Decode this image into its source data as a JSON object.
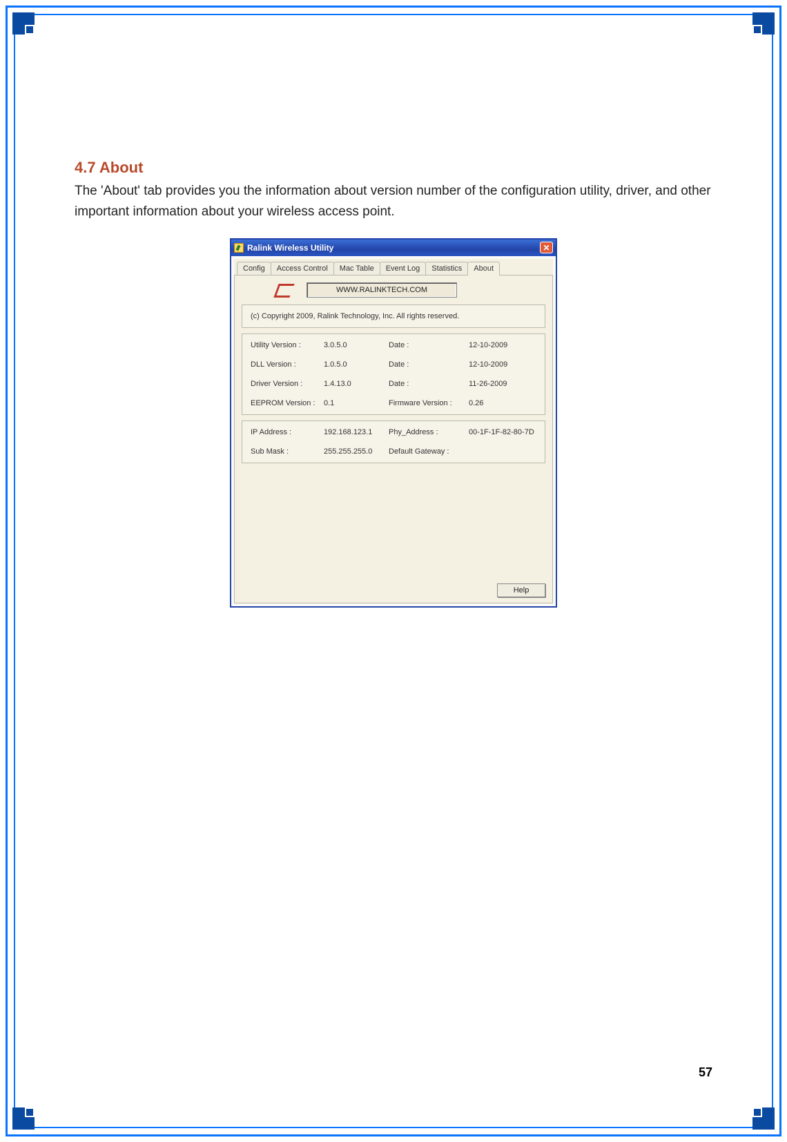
{
  "document": {
    "heading": "4.7 About",
    "paragraph": "The 'About' tab provides you the information about version number of the configuration utility, driver, and other important information about your wireless access point.",
    "page_number": "57"
  },
  "window": {
    "title": "Ralink Wireless Utility",
    "tabs": [
      "Config",
      "Access Control",
      "Mac Table",
      "Event Log",
      "Statistics",
      "About"
    ],
    "active_tab": "About",
    "url_button": "WWW.RALINKTECH.COM",
    "copyright": "(c) Copyright 2009, Ralink Technology, Inc.  All rights reserved.",
    "versions": {
      "utility": {
        "label": "Utility Version :",
        "value": "3.0.5.0",
        "date_label": "Date :",
        "date": "12-10-2009"
      },
      "dll": {
        "label": "DLL Version :",
        "value": "1.0.5.0",
        "date_label": "Date :",
        "date": "12-10-2009"
      },
      "driver": {
        "label": "Driver Version :",
        "value": "1.4.13.0",
        "date_label": "Date :",
        "date": "11-26-2009"
      },
      "eeprom": {
        "label": "EEPROM Version :",
        "value": "0.1",
        "fw_label": "Firmware Version :",
        "fw": "0.26"
      }
    },
    "network": {
      "ip_label": "IP Address :",
      "ip": "192.168.123.1",
      "phy_label": "Phy_Address :",
      "phy": "00-1F-1F-82-80-7D",
      "mask_label": "Sub Mask :",
      "mask": "255.255.255.0",
      "gw_label": "Default Gateway :",
      "gw": ""
    },
    "help_button": "Help"
  }
}
